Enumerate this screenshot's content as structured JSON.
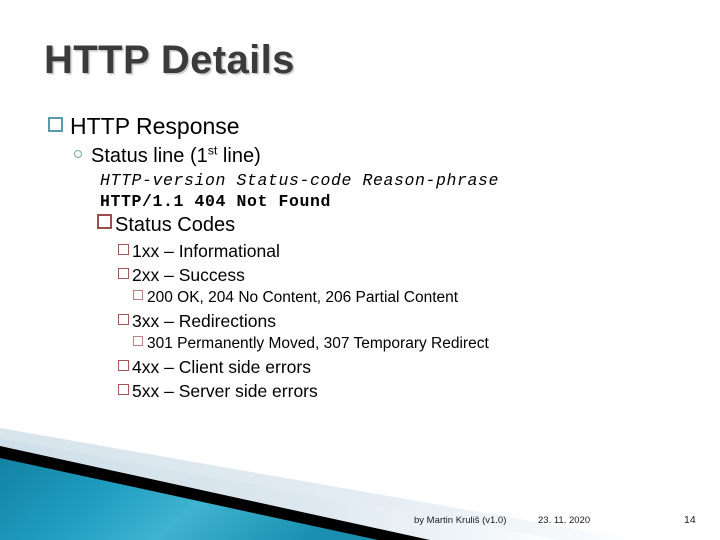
{
  "slide": {
    "title": "HTTP Details",
    "page_number": "14",
    "accent_colors": {
      "title_text": "#3b3b3b",
      "level1_bullet": "#5b9aab",
      "level2_bullet": "#7aa7b5",
      "status_bullet": "#9e4b4b",
      "band_teal": "#1b94b4",
      "band_black": "#000000",
      "band_pale": "#dde8ef"
    }
  },
  "outline": {
    "l1_http_response": "HTTP Response",
    "l2_status_line_pre": "Status line (1",
    "l2_status_line_sup": "st",
    "l2_status_line_post": " line)",
    "code_syntax": "HTTP-version Status-code Reason-phrase",
    "code_example": "HTTP/1.1 404 Not Found",
    "l3_status_codes": "Status Codes",
    "codes": [
      {
        "label": "1xx – Informational",
        "level": 4
      },
      {
        "label": "2xx – Success",
        "level": 4
      },
      {
        "label": "200 OK, 204 No Content, 206 Partial Content",
        "level": 5
      },
      {
        "label": "3xx – Redirections",
        "level": 4
      },
      {
        "label": "301 Permanently Moved, 307 Temporary Redirect",
        "level": 5
      },
      {
        "label": "4xx – Client side errors",
        "level": 4
      },
      {
        "label": "5xx – Server side errors",
        "level": 4
      }
    ]
  },
  "footer": {
    "author": "by Martin Kruliš (v1.0)",
    "date": "23. 11. 2020",
    "page": "14"
  }
}
